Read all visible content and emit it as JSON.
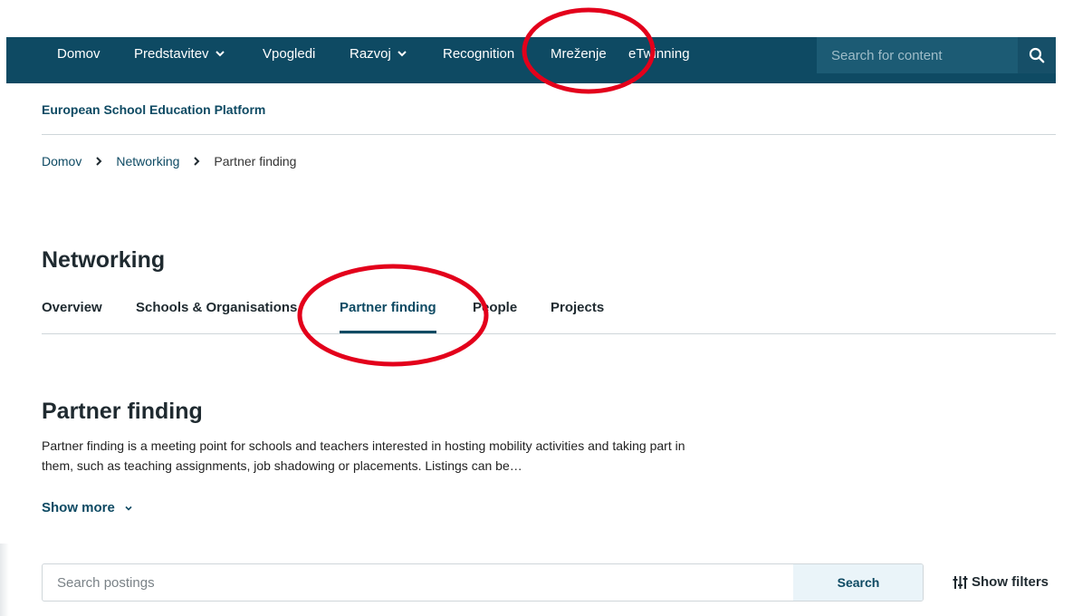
{
  "nav": {
    "items": [
      {
        "label": "Domov",
        "has_dropdown": false
      },
      {
        "label": "Predstavitev",
        "has_dropdown": true
      },
      {
        "label": "Vpogledi",
        "has_dropdown": false
      },
      {
        "label": "Razvoj",
        "has_dropdown": true
      },
      {
        "label": "Recognition",
        "has_dropdown": false
      },
      {
        "label": "Mreženje",
        "has_dropdown": false
      },
      {
        "label": "eTwinning",
        "has_dropdown": false
      }
    ],
    "search_placeholder": "Search for content",
    "search_icon": "search-icon"
  },
  "site": {
    "title": "European School Education Platform"
  },
  "breadcrumb": {
    "items": [
      "Domov",
      "Networking"
    ],
    "current": "Partner finding",
    "separator_icon": "chevron-right-icon"
  },
  "section": {
    "title": "Networking",
    "tabs": [
      {
        "label": "Overview",
        "active": false
      },
      {
        "label": "Schools & Organisations",
        "active": false
      },
      {
        "label": "Partner finding",
        "active": true
      },
      {
        "label": "People",
        "active": false
      },
      {
        "label": "Projects",
        "active": false
      }
    ]
  },
  "page": {
    "title": "Partner finding",
    "description": "Partner finding is a meeting point for schools and teachers interested in hosting mobility activities and taking part in them, such as teaching assignments, job shadowing or placements. Listings can be…",
    "show_more": "Show more"
  },
  "postings": {
    "placeholder": "Search postings",
    "search_label": "Search",
    "filters_label": "Show filters",
    "filters_icon": "sliders-icon"
  },
  "colors": {
    "nav_bg": "#0e4a63",
    "accent": "#0e4a63",
    "annotation": "#e3001b"
  }
}
